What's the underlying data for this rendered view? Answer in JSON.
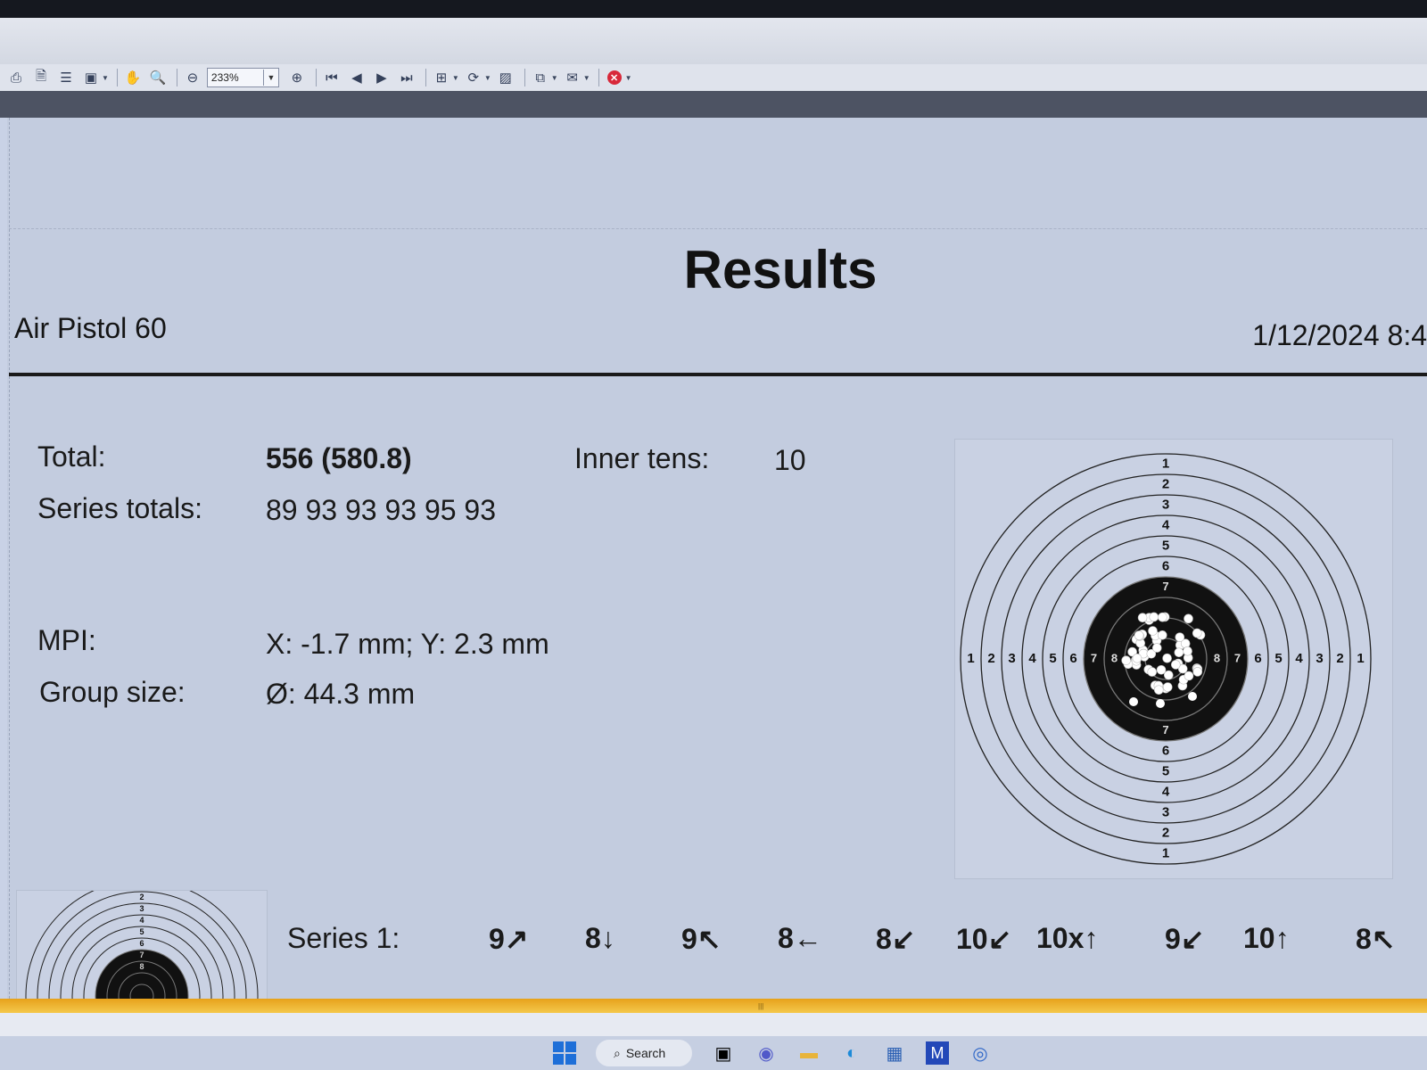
{
  "toolbar": {
    "zoom_value": "233%",
    "icons": [
      "print-icon",
      "export-icon",
      "page-layout-icon",
      "save-icon",
      "hand-tool-icon",
      "zoom-tool-icon",
      "zoom-out-icon",
      "zoom-in-icon",
      "first-page-icon",
      "prev-page-icon",
      "next-page-icon",
      "last-page-icon",
      "tree-icon",
      "refresh-icon",
      "page-setup-icon",
      "copy-icon",
      "email-icon",
      "close-icon"
    ]
  },
  "report": {
    "title": "Results",
    "discipline": "Air Pistol 60",
    "datetime": "1/12/2024 8:4"
  },
  "summary": {
    "total_label": "Total:",
    "total_value": "556 (580.8)",
    "inner_tens_label": "Inner tens:",
    "inner_tens_value": "10",
    "series_totals_label": "Series totals:",
    "series_totals_value": "89 93 93 93 95 93",
    "mpi_label": "MPI:",
    "mpi_value": "X: -1.7 mm; Y: 2.3 mm",
    "group_size_label": "Group size:",
    "group_size_value": "Ø: 44.3 mm"
  },
  "target": {
    "ring_numbers": [
      "1",
      "2",
      "3",
      "4",
      "5",
      "6",
      "7",
      "8"
    ],
    "colors": {
      "black": "#111111",
      "ring_line": "#222222",
      "shot": "#ffffff"
    }
  },
  "series1": {
    "label": "Series 1:",
    "shots": [
      "9↗",
      "8↓",
      "9↖",
      "8←",
      "8↙",
      "10↙",
      "10x↑",
      "9↙",
      "10↑",
      "8↖"
    ]
  },
  "taskbar": {
    "search_label": "Search",
    "icons": [
      "windows-start-icon",
      "search-icon",
      "task-view-icon",
      "meet-icon",
      "file-explorer-icon",
      "edge-icon",
      "store-icon",
      "app-icon",
      "target-app-icon"
    ]
  }
}
